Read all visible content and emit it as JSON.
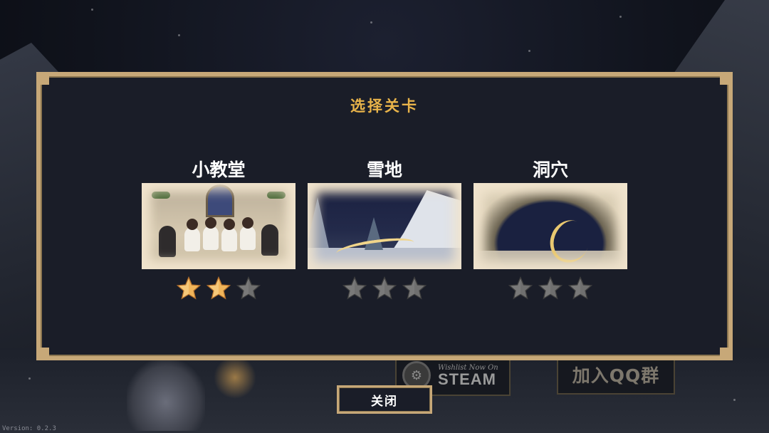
{
  "dialog": {
    "title": "选择关卡"
  },
  "levels": [
    {
      "name": "小教堂",
      "stars_earned": 2,
      "stars_total": 3,
      "art": "chapel"
    },
    {
      "name": "雪地",
      "stars_earned": 0,
      "stars_total": 3,
      "art": "snowfield"
    },
    {
      "name": "洞穴",
      "stars_earned": 0,
      "stars_total": 3,
      "art": "cave"
    }
  ],
  "buttons": {
    "close_label": "关闭",
    "steam_sub": "Wishlist Now On",
    "steam_main": "STEAM",
    "qq_label": "加入QQ群"
  },
  "version_label": "Version: 0.2.3",
  "colors": {
    "frame_gold": "#c7a878",
    "title_gold": "#e8b34a",
    "panel_bg": "#1a1d28",
    "star_earned": "#f1b55a",
    "star_empty": "#6f6f6f"
  }
}
